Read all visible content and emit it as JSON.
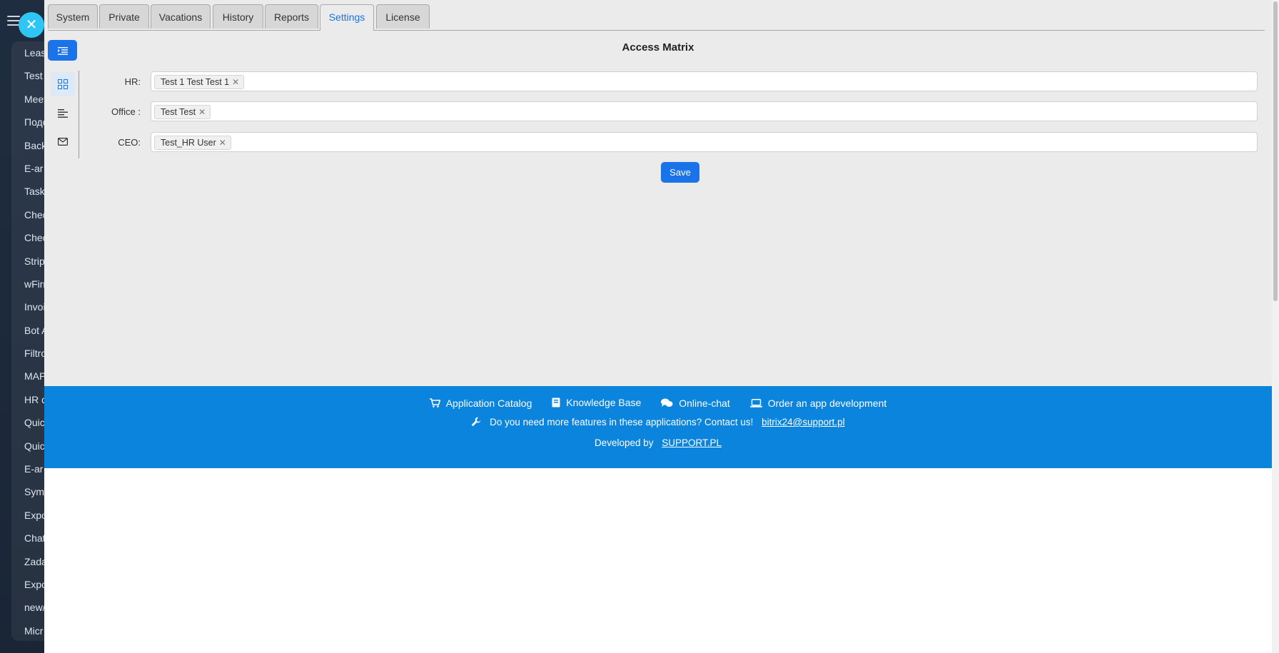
{
  "background_menu": {
    "items": [
      "Lease",
      "Test",
      "Meet",
      "Подо",
      "Back",
      "E-ar",
      "TaskT",
      "Chec",
      "Chec",
      "Strip",
      "wFirr",
      "Invoi",
      "Bot A",
      "Filtro",
      "MAP",
      "HR d",
      "Quic",
      "Quic",
      "E-ar",
      "Sym",
      "Expo",
      "Chat",
      "Zada",
      "Expo",
      "new/",
      "Micr"
    ]
  },
  "tabs": [
    {
      "label": "System"
    },
    {
      "label": "Private"
    },
    {
      "label": "Vacations"
    },
    {
      "label": "History"
    },
    {
      "label": "Reports"
    },
    {
      "label": "Settings"
    },
    {
      "label": "License"
    }
  ],
  "active_tab": "Settings",
  "page_title": "Access Matrix",
  "access": {
    "hr": {
      "label": "HR:",
      "chip": "Test 1 Test Test 1"
    },
    "office": {
      "label": "Office :",
      "chip": "Test Test"
    },
    "ceo": {
      "label": "CEO:",
      "chip": "Test_HR User"
    }
  },
  "save_label": "Save",
  "footer": {
    "app_catalog": "Application Catalog",
    "knowledge_base": "Knowledge Base",
    "online_chat": "Online-chat",
    "order_dev": "Order an app development",
    "more_features": "Do you need more features in these applications? Contact us!",
    "email": "bitrix24@support.pl",
    "developed_by": "Developed by",
    "developer": "SUPPORT.PL"
  },
  "colors": {
    "accent": "#1a73e8",
    "footer_bg": "#0a84dd",
    "close_btn": "#2fc6f6"
  }
}
